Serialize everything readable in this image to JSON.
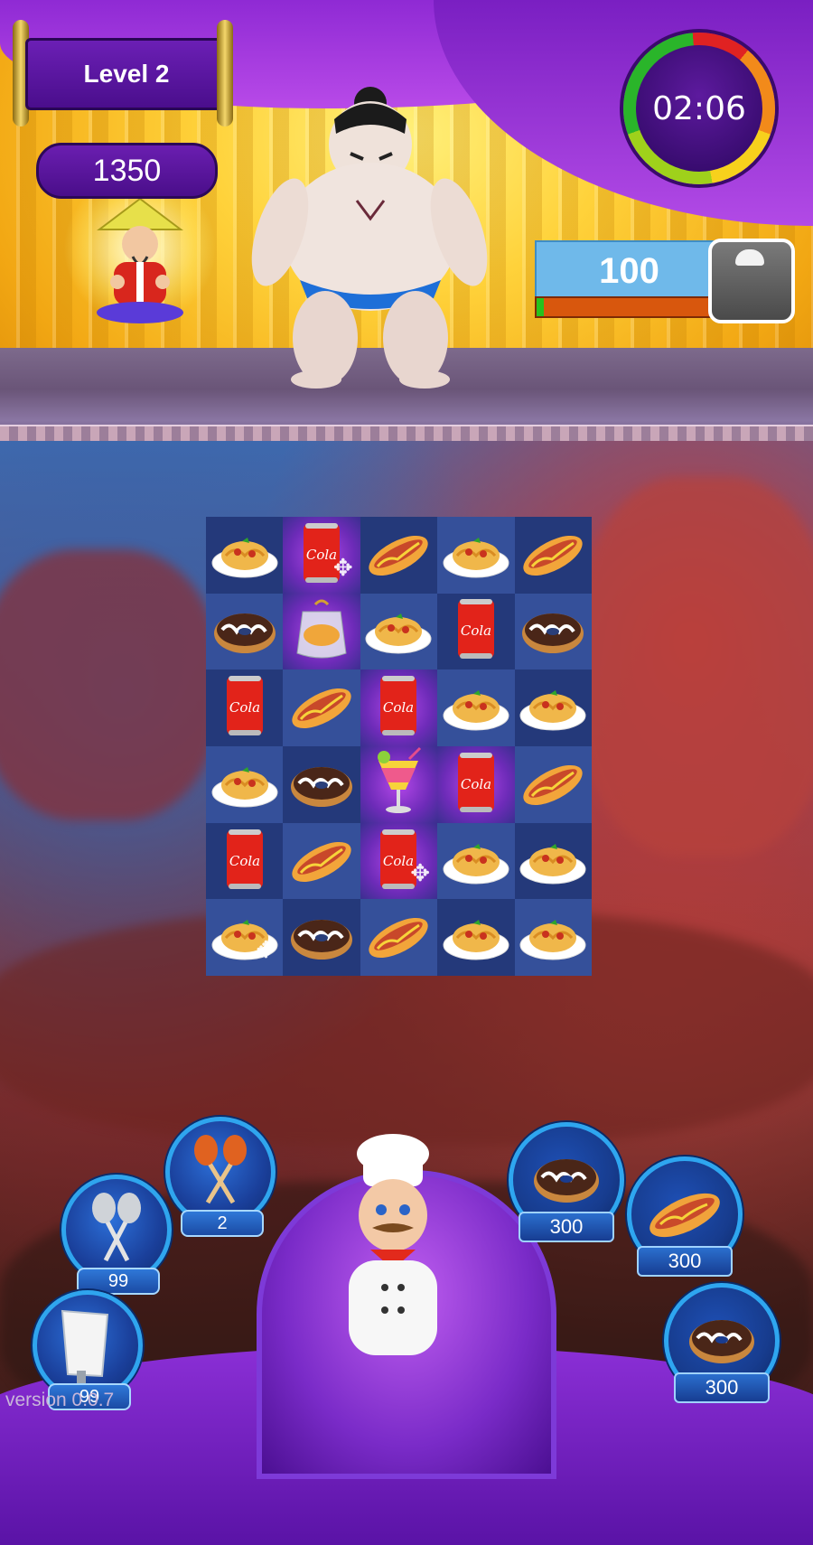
{
  "hud": {
    "level_label": "Level 2",
    "score": "1350",
    "timer": "02:06",
    "weight": "100",
    "weight_progress": 0.04
  },
  "board": {
    "rows": 6,
    "cols": 5,
    "tiles": [
      [
        "spaghetti",
        "cola",
        "hotdog",
        "spaghetti",
        "hotdog"
      ],
      [
        "donut",
        "bagged-pie",
        "spaghetti",
        "cola",
        "donut"
      ],
      [
        "cola",
        "hotdog",
        "cola",
        "spaghetti",
        "spaghetti"
      ],
      [
        "spaghetti",
        "donut",
        "cocktail",
        "cola",
        "hotdog"
      ],
      [
        "cola",
        "hotdog",
        "cola",
        "spaghetti",
        "spaghetti"
      ],
      [
        "spaghetti",
        "donut",
        "hotdog",
        "spaghetti",
        "spaghetti"
      ]
    ],
    "highlighted_cells": [
      "0-1",
      "1-1",
      "2-2",
      "3-2",
      "3-3",
      "4-2"
    ],
    "hint_cells": [
      "0-1",
      "4-2",
      "5-0"
    ],
    "cola_label": "Cola"
  },
  "boosters": [
    {
      "name": "orange-lollipops",
      "count": "2"
    },
    {
      "name": "silver-lollipops",
      "count": "99"
    },
    {
      "name": "cleaver",
      "count": "99"
    }
  ],
  "goals": [
    {
      "item": "donut",
      "count": "300"
    },
    {
      "item": "hotdog",
      "count": "300"
    },
    {
      "item": "donut",
      "count": "300"
    }
  ],
  "footer": {
    "version": "version 0.0.7"
  }
}
